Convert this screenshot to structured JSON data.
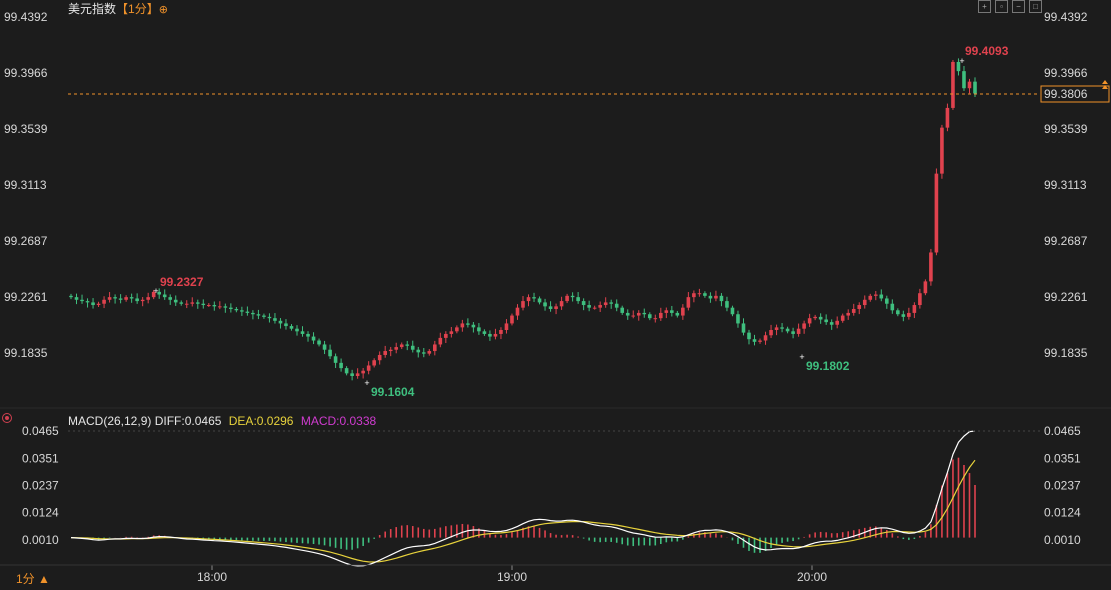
{
  "header": {
    "title": "美元指数",
    "period": "【1分】",
    "crosshair_icon": "⊕",
    "toolbar_icons": [
      "crosshair-icon",
      "fit-icon",
      "zoom-out-icon",
      "fullscreen-icon"
    ]
  },
  "price_axis": [
    "99.4392",
    "99.3966",
    "99.3539",
    "99.3113",
    "99.2687",
    "99.2261",
    "99.1835"
  ],
  "current_price": "99.3806",
  "annotations": {
    "high_left": "99.2327",
    "low_left": "99.1604",
    "low_right": "99.1802",
    "high_right": "99.4093"
  },
  "macd_panel": {
    "label": "MACD(26,12,9)",
    "diff": "DIFF:0.0465",
    "dea": "DEA:0.0296",
    "macd": "MACD:0.0338",
    "axis": [
      "0.0465",
      "0.0351",
      "0.0237",
      "0.0124",
      "0.0010"
    ]
  },
  "time_axis": [
    "18:00",
    "19:00",
    "20:00"
  ],
  "bottom_period": "1分 ▲",
  "colors": {
    "up": "#e0424e",
    "down": "#3fbf7f",
    "diff": "#ffffff",
    "dea": "#e8d33c",
    "macd_label": "#d03cd0",
    "price_line": "#f0922a",
    "background": "#1c1c1c"
  },
  "chart_data": {
    "type": "candlestick",
    "instrument": "美元指数",
    "interval": "1分",
    "y_range": [
      99.16,
      99.44
    ],
    "x_ticks": [
      "18:00",
      "19:00",
      "20:00"
    ],
    "close_series": [
      99.226,
      99.224,
      99.223,
      99.222,
      99.22,
      99.221,
      99.224,
      99.226,
      99.225,
      99.224,
      99.226,
      99.225,
      99.223,
      99.224,
      99.226,
      99.23,
      99.228,
      99.226,
      99.224,
      99.222,
      99.221,
      99.221,
      99.222,
      99.221,
      99.22,
      99.22,
      99.219,
      99.219,
      99.218,
      99.217,
      99.216,
      99.215,
      99.214,
      99.213,
      99.212,
      99.211,
      99.21,
      99.208,
      99.206,
      99.204,
      99.202,
      99.2,
      99.198,
      99.196,
      99.193,
      99.19,
      99.186,
      99.181,
      99.176,
      99.172,
      99.168,
      99.166,
      99.168,
      99.17,
      99.174,
      99.178,
      99.182,
      99.185,
      99.186,
      99.188,
      99.19,
      99.189,
      99.186,
      99.184,
      99.183,
      99.185,
      99.19,
      99.195,
      99.198,
      99.2,
      99.203,
      99.206,
      99.205,
      99.203,
      99.2,
      99.198,
      99.196,
      99.198,
      99.201,
      99.206,
      99.212,
      99.218,
      99.223,
      99.226,
      99.225,
      99.222,
      99.219,
      99.217,
      99.219,
      99.223,
      99.227,
      99.226,
      99.223,
      99.22,
      99.218,
      99.218,
      99.22,
      99.222,
      99.221,
      99.218,
      99.214,
      99.212,
      99.212,
      99.214,
      99.213,
      99.21,
      99.21,
      99.214,
      99.216,
      99.214,
      99.212,
      99.218,
      99.226,
      99.229,
      99.229,
      99.227,
      99.225,
      99.227,
      99.223,
      99.218,
      99.213,
      99.206,
      99.199,
      99.194,
      99.192,
      99.193,
      99.197,
      99.201,
      99.203,
      99.202,
      99.2,
      99.198,
      99.202,
      99.206,
      99.21,
      99.211,
      99.209,
      99.207,
      99.205,
      99.208,
      99.212,
      99.214,
      99.217,
      99.22,
      99.224,
      99.227,
      99.228,
      99.225,
      99.221,
      99.216,
      99.213,
      99.211,
      99.214,
      99.22,
      99.229,
      99.238,
      99.26,
      99.32,
      99.355,
      99.37,
      99.405,
      99.398,
      99.385,
      99.39,
      99.381
    ],
    "series": [
      {
        "name": "DIFF",
        "panel": "macd"
      },
      {
        "name": "DEA",
        "panel": "macd"
      },
      {
        "name": "MACD",
        "panel": "macd",
        "type": "histogram"
      }
    ],
    "macd_range": [
      0.001,
      0.0465
    ]
  }
}
